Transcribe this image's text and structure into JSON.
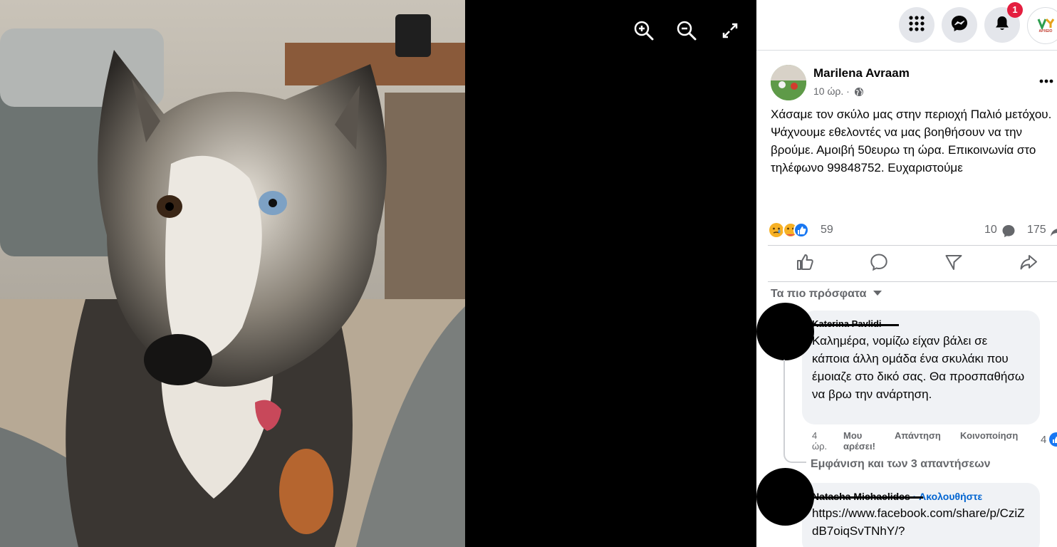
{
  "viewer": {
    "photo_alt": "husky dog photo",
    "tools": [
      {
        "name": "zoom-in-icon"
      },
      {
        "name": "zoom-out-icon"
      },
      {
        "name": "fullscreen-icon"
      }
    ]
  },
  "topbar": {
    "notifications_badge": "1",
    "profile_logo_text": "ΑΡΧΕΙΟ"
  },
  "post": {
    "author": "Marilena Avraam",
    "time": "10 ώρ. ·",
    "text": "Χάσαμε τον σκύλο μας στην περιοχή Παλιό μετόχου. Ψάχνουμε εθελοντές να μας βοηθήσουν να την βρούμε. Αμοιβή 50ευρω τη ώρα. Επικοινωνία στο τηλέφωνο 99848752. Ευχαριστούμε",
    "reactions_count": "59",
    "comments_count": "10",
    "shares_count": "175",
    "sort_label": "Τα πιο πρόσφατα"
  },
  "comments": [
    {
      "author": "Katerina Pavlidi",
      "text": "Καλημέρα, νομίζω είχαν βάλει σε κάποια άλλη ομάδα ένα σκυλάκι που έμοιαζε στο δικό σας. Θα προσπαθήσω να βρω την ανάρτηση.",
      "time": "4 ώρ.",
      "like_label": "Μου αρέσει!",
      "reply_label": "Απάντηση",
      "share_label": "Κοινοποίηση",
      "likes": "4",
      "view_replies": "Εμφάνιση και των 3 απαντήσεων"
    },
    {
      "author": "Natasha Michaelides",
      "follow_label": "· Ακολουθήστε",
      "text": "https://www.facebook.com/share/p/CziZdB7oiqSvTNhY/?"
    }
  ],
  "colors": {
    "link_blue": "#0064d1",
    "bubble_gray": "#f0f2f5",
    "text_gray": "#65676b",
    "badge_red": "#e41e3f"
  }
}
